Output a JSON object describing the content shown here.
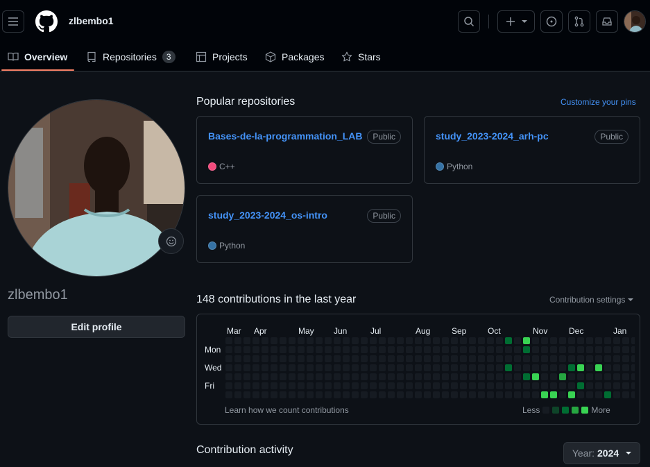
{
  "header": {
    "username": "zlbembo1",
    "icons": [
      "hamburger-icon",
      "github-logo",
      "search-icon",
      "plus-icon",
      "issues-icon",
      "pull-request-icon",
      "inbox-icon"
    ]
  },
  "tabs": [
    {
      "label": "Overview",
      "icon": "book-icon"
    },
    {
      "label": "Repositories",
      "icon": "repo-icon",
      "count": "3"
    },
    {
      "label": "Projects",
      "icon": "table-icon"
    },
    {
      "label": "Packages",
      "icon": "package-icon"
    },
    {
      "label": "Stars",
      "icon": "star-icon"
    }
  ],
  "profile": {
    "name": "zlbembo1",
    "edit_label": "Edit profile"
  },
  "popular": {
    "title": "Popular repositories",
    "customize": "Customize your pins",
    "repos": [
      {
        "name": "Bases-de-la-programmation_LAB",
        "visibility": "Public",
        "language": "C++",
        "color": "#f34b7d"
      },
      {
        "name": "study_2023-2024_arh-pc",
        "visibility": "Public",
        "language": "Python",
        "color": "#3572A5"
      },
      {
        "name": "study_2023-2024_os-intro",
        "visibility": "Public",
        "language": "Python",
        "color": "#3572A5"
      }
    ]
  },
  "contributions": {
    "title": "148 contributions in the last year",
    "settings": "Contribution settings",
    "months": [
      "Mar",
      "Apr",
      "May",
      "Jun",
      "Jul",
      "Aug",
      "Sep",
      "Oct",
      "Nov",
      "Dec",
      "Jan"
    ],
    "days": [
      "Mon",
      "Wed",
      "Fri"
    ],
    "learn": "Learn how we count contributions",
    "less": "Less",
    "more": "More",
    "colors": [
      "#161b22",
      "#0e4429",
      "#006d32",
      "#26a641",
      "#39d353"
    ]
  },
  "activity": {
    "title": "Contribution activity",
    "year_label": "Year:",
    "year_value": "2024"
  }
}
